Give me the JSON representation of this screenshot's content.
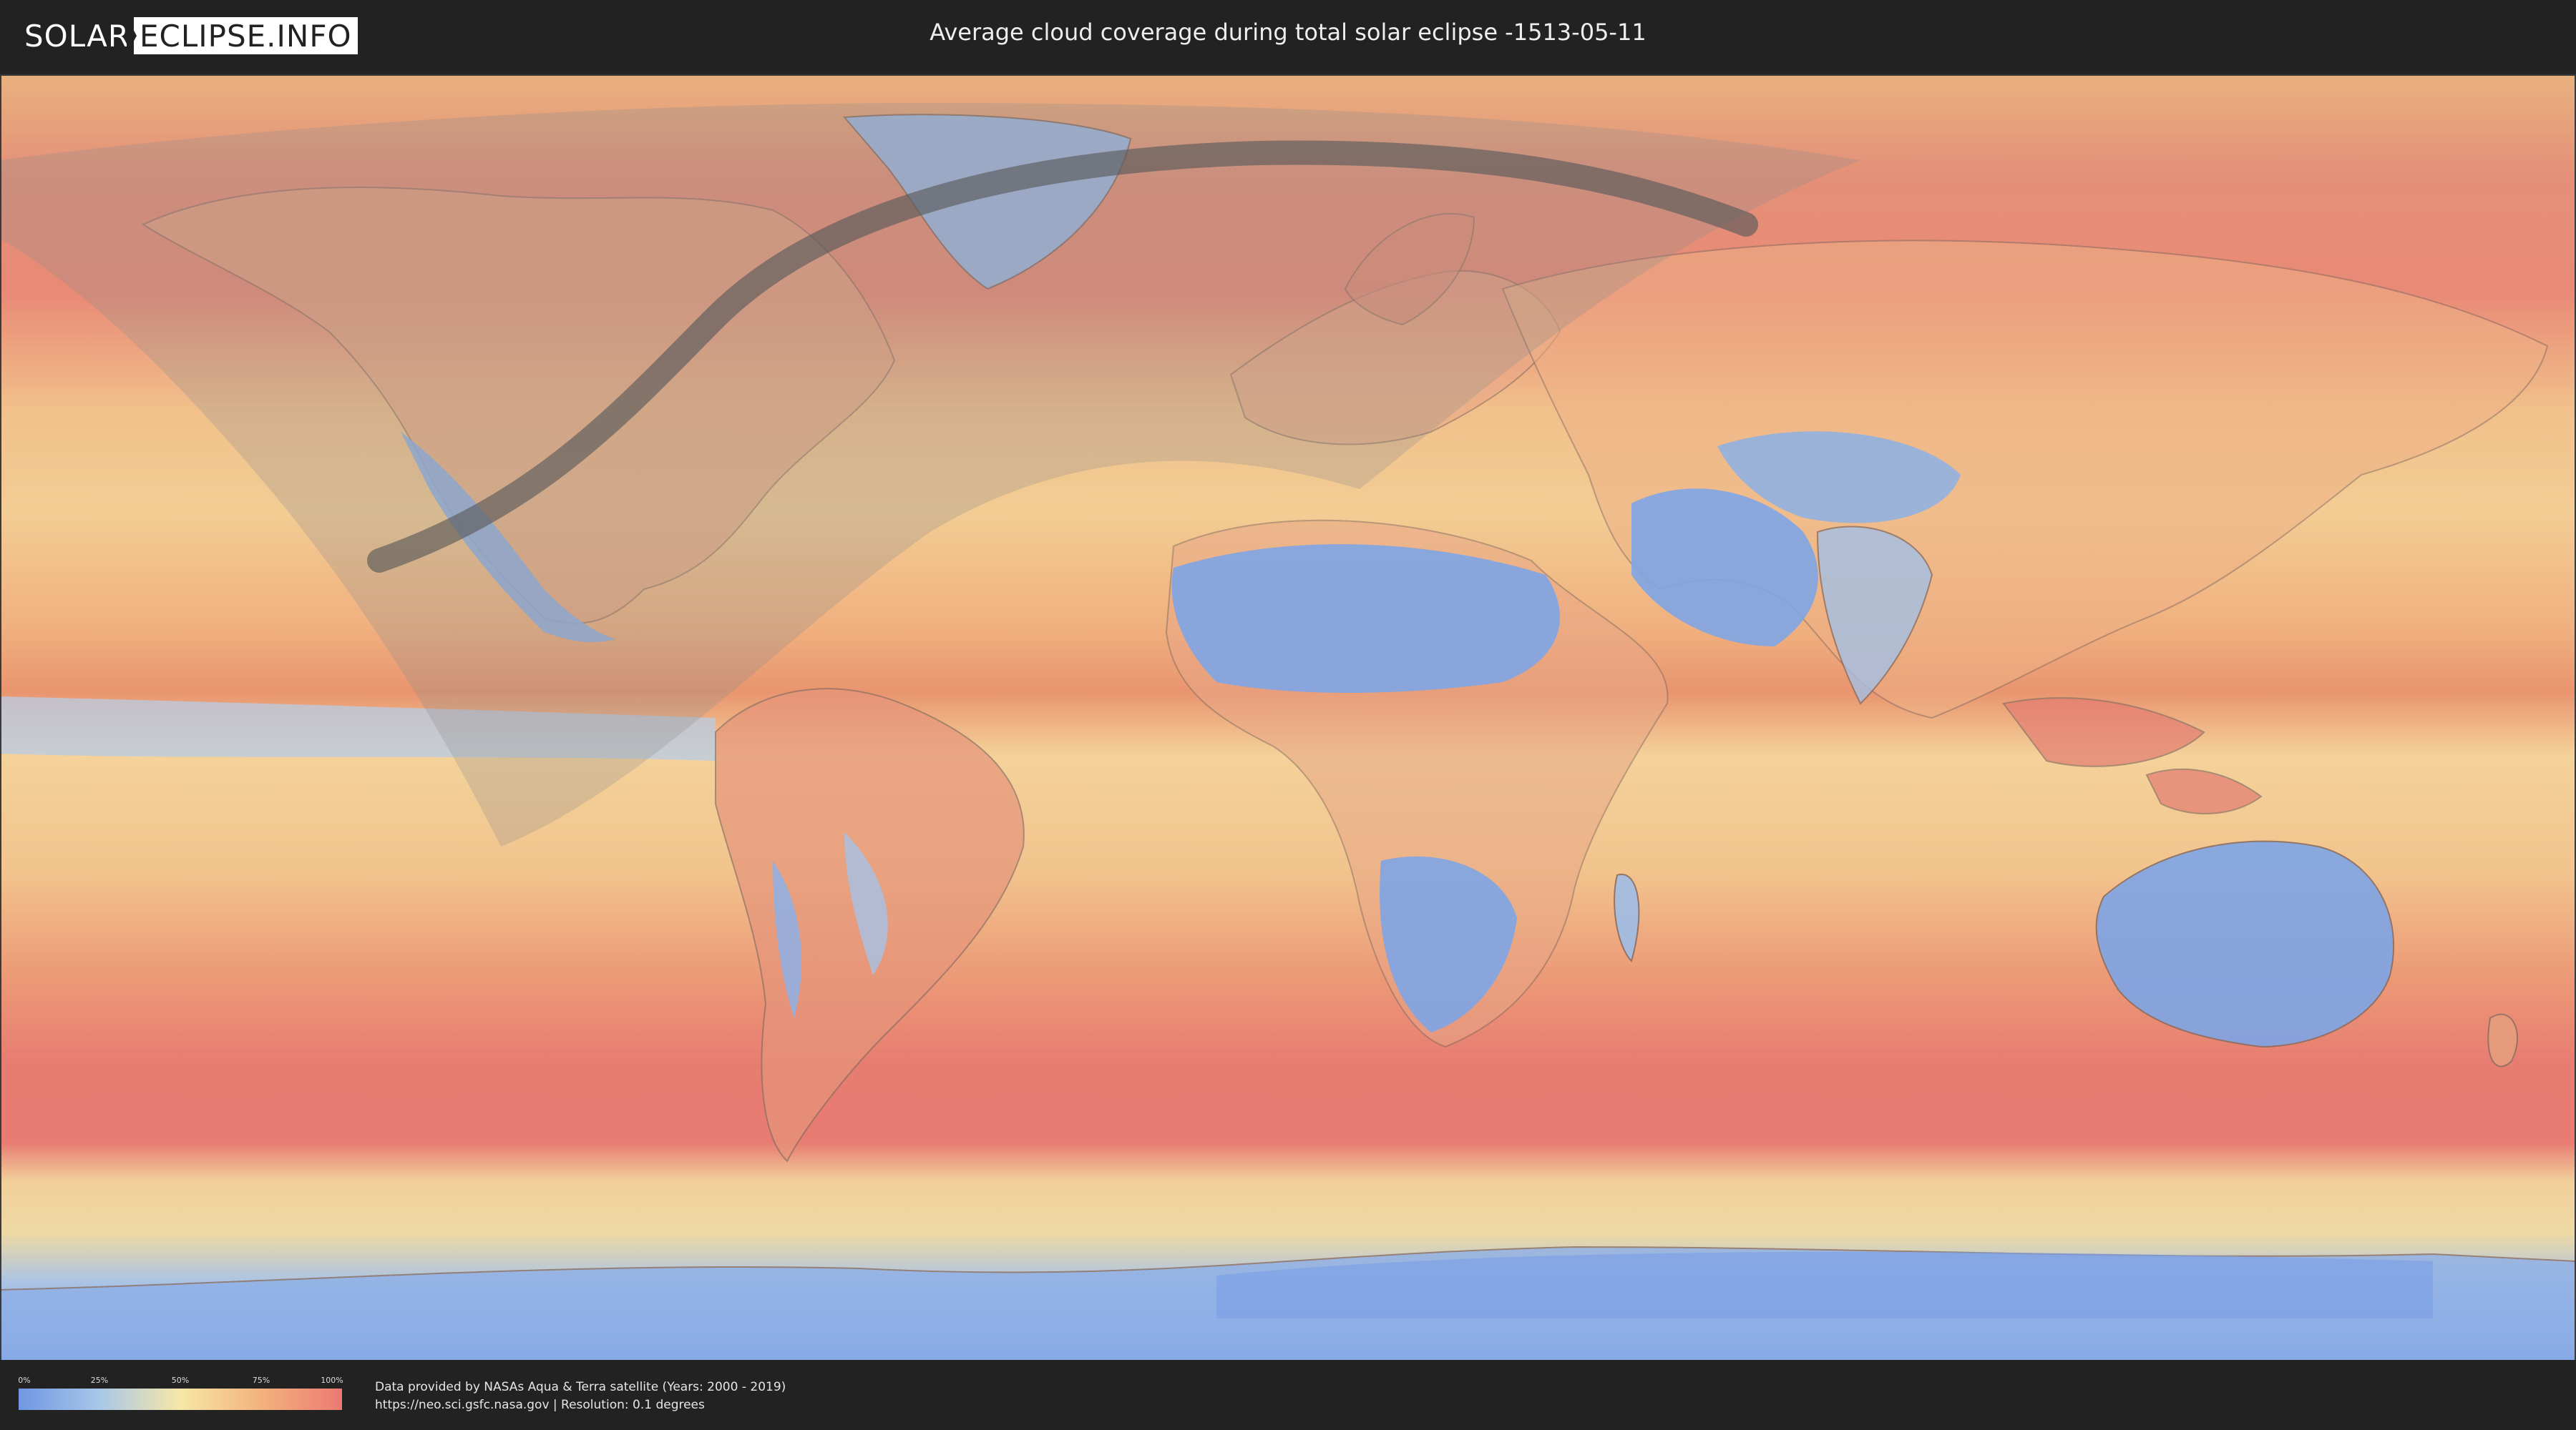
{
  "header": {
    "logo_solar": "SOLAR",
    "logo_eclipse": "ECLIPSE.INFO",
    "title": "Average cloud coverage during total solar eclipse -1513-05-11"
  },
  "icons": {
    "logo": "solar-eclipse-logo",
    "map": "world-cloud-cover-map"
  },
  "colors": {
    "header_bg": "#222222",
    "scale_0": "#6f97e3",
    "scale_25": "#a9c7e8",
    "scale_50": "#f6e7a7",
    "scale_75": "#f3b27d",
    "scale_100": "#ec7a72",
    "eclipse_path": "#5a5a5a",
    "penumbra_overlay": "#8a8a8a"
  },
  "legend": {
    "ticks": [
      "0%",
      "25%",
      "50%",
      "75%",
      "100%"
    ]
  },
  "footer": {
    "credit_line1": "Data provided by NASAs Aqua & Terra satellite (Years: 2000 - 2019)",
    "credit_line2": "https://neo.sci.gsfc.nasa.gov | Resolution: 0.1 degrees"
  }
}
